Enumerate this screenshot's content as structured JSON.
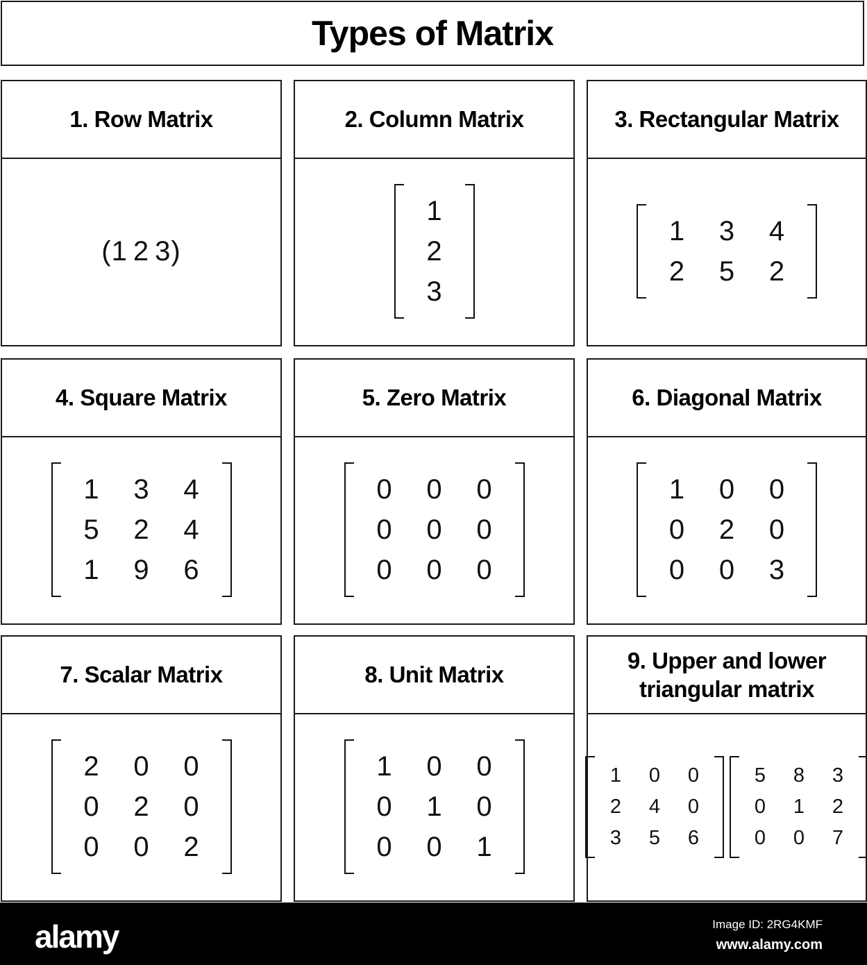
{
  "title": "Types of Matrix",
  "cells": [
    {
      "label": "1. Row Matrix",
      "type": "row",
      "values": [
        "(1",
        "2",
        "3)"
      ]
    },
    {
      "label": "2. Column Matrix",
      "type": "matrix",
      "rows": [
        [
          "1"
        ],
        [
          "2"
        ],
        [
          "3"
        ]
      ]
    },
    {
      "label": "3. Rectangular Matrix",
      "type": "matrix",
      "rows": [
        [
          "1",
          "3",
          "4"
        ],
        [
          "2",
          "5",
          "2"
        ]
      ]
    },
    {
      "label": "4. Square Matrix",
      "type": "matrix",
      "rows": [
        [
          "1",
          "3",
          "4"
        ],
        [
          "5",
          "2",
          "4"
        ],
        [
          "1",
          "9",
          "6"
        ]
      ]
    },
    {
      "label": "5. Zero Matrix",
      "type": "matrix",
      "rows": [
        [
          "0",
          "0",
          "0"
        ],
        [
          "0",
          "0",
          "0"
        ],
        [
          "0",
          "0",
          "0"
        ]
      ]
    },
    {
      "label": "6. Diagonal Matrix",
      "type": "matrix",
      "rows": [
        [
          "1",
          "0",
          "0"
        ],
        [
          "0",
          "2",
          "0"
        ],
        [
          "0",
          "0",
          "3"
        ]
      ]
    },
    {
      "label": "7. Scalar Matrix",
      "type": "matrix",
      "rows": [
        [
          "2",
          "0",
          "0"
        ],
        [
          "0",
          "2",
          "0"
        ],
        [
          "0",
          "0",
          "2"
        ]
      ]
    },
    {
      "label": "8. Unit Matrix",
      "type": "matrix",
      "rows": [
        [
          "1",
          "0",
          "0"
        ],
        [
          "0",
          "1",
          "0"
        ],
        [
          "0",
          "0",
          "1"
        ]
      ]
    },
    {
      "label": "9. Upper and lower triangular matrix",
      "type": "pair",
      "matrices": [
        [
          [
            "1",
            "0",
            "0"
          ],
          [
            "2",
            "4",
            "0"
          ],
          [
            "3",
            "5",
            "6"
          ]
        ],
        [
          [
            "5",
            "8",
            "3"
          ],
          [
            "0",
            "1",
            "2"
          ],
          [
            "0",
            "0",
            "7"
          ]
        ]
      ]
    }
  ],
  "footer": {
    "logo": "alamy",
    "image_id": "Image ID: 2RG4KMF",
    "url": "www.alamy.com"
  }
}
